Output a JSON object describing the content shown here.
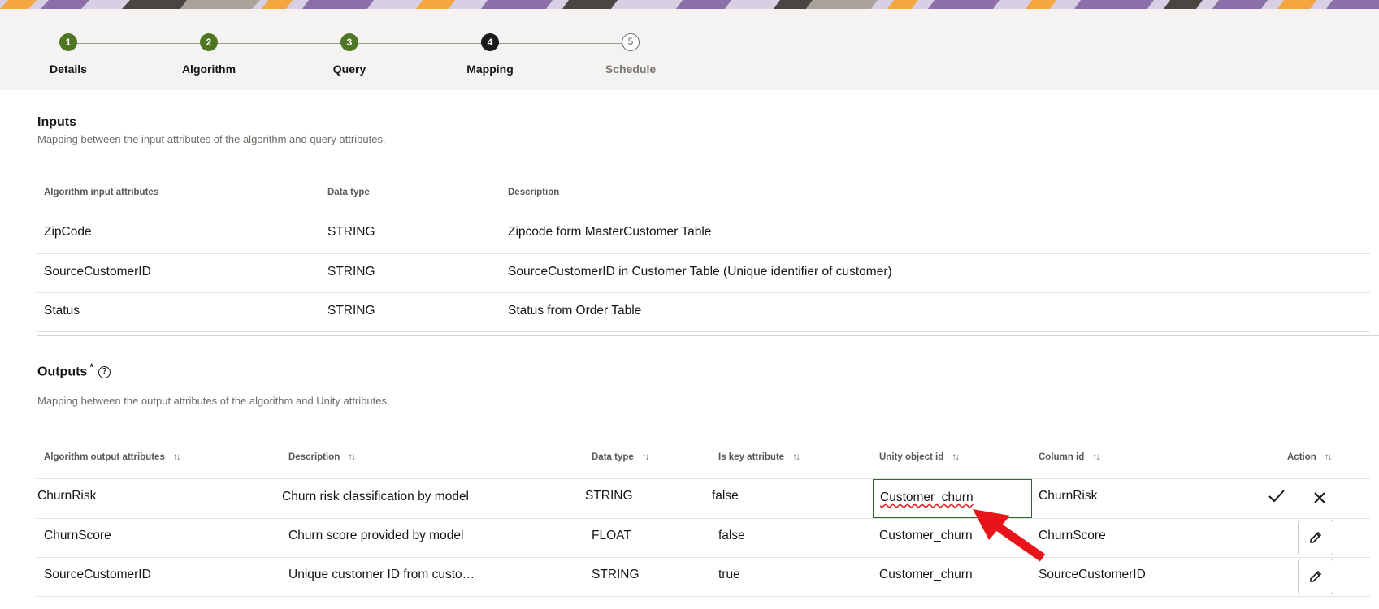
{
  "stepper": {
    "steps": [
      {
        "num": "1",
        "label": "Details",
        "state": "done"
      },
      {
        "num": "2",
        "label": "Algorithm",
        "state": "done"
      },
      {
        "num": "3",
        "label": "Query",
        "state": "done"
      },
      {
        "num": "4",
        "label": "Mapping",
        "state": "current"
      },
      {
        "num": "5",
        "label": "Schedule",
        "state": "todo"
      }
    ]
  },
  "inputs": {
    "title": "Inputs",
    "description": "Mapping between the input attributes of the algorithm and query attributes.",
    "headers": [
      "Algorithm input attributes",
      "Data type",
      "Description"
    ],
    "rows": [
      [
        "ZipCode",
        "STRING",
        "Zipcode form MasterCustomer Table"
      ],
      [
        "SourceCustomerID",
        "STRING",
        "SourceCustomerID in Customer Table (Unique identifier of customer)"
      ],
      [
        "Status",
        "STRING",
        "Status from Order Table"
      ]
    ]
  },
  "outputs": {
    "title": "Outputs",
    "required_mark": "*",
    "help_icon": "?",
    "description": "Mapping between the output attributes of the algorithm and Unity attributes.",
    "headers": [
      "Algorithm output attributes",
      "Description",
      "Data type",
      "Is key attribute",
      "Unity object id",
      "Column id",
      "Action"
    ],
    "sort_glyph": "↑↓",
    "rows": [
      [
        "ChurnRisk",
        "Churn risk classification by model",
        "STRING",
        "false",
        "Customer_churn",
        "ChurnRisk"
      ],
      [
        "ChurnScore",
        "Churn score provided by model",
        "FLOAT",
        "false",
        "Customer_churn",
        "ChurnScore"
      ],
      [
        "SourceCustomerID",
        "Unique customer ID from custo…",
        "STRING",
        "true",
        "Customer_churn",
        "SourceCustomerID"
      ]
    ]
  },
  "icons": {
    "confirm": "check-icon",
    "cancel": "close-icon",
    "edit": "pencil-icon",
    "annotation": "red-arrow"
  },
  "colors": {
    "step_done": "#4f7623",
    "step_current": "#1c1b19",
    "input_border": "#2e6b2e",
    "arrow": "#e8141a"
  }
}
